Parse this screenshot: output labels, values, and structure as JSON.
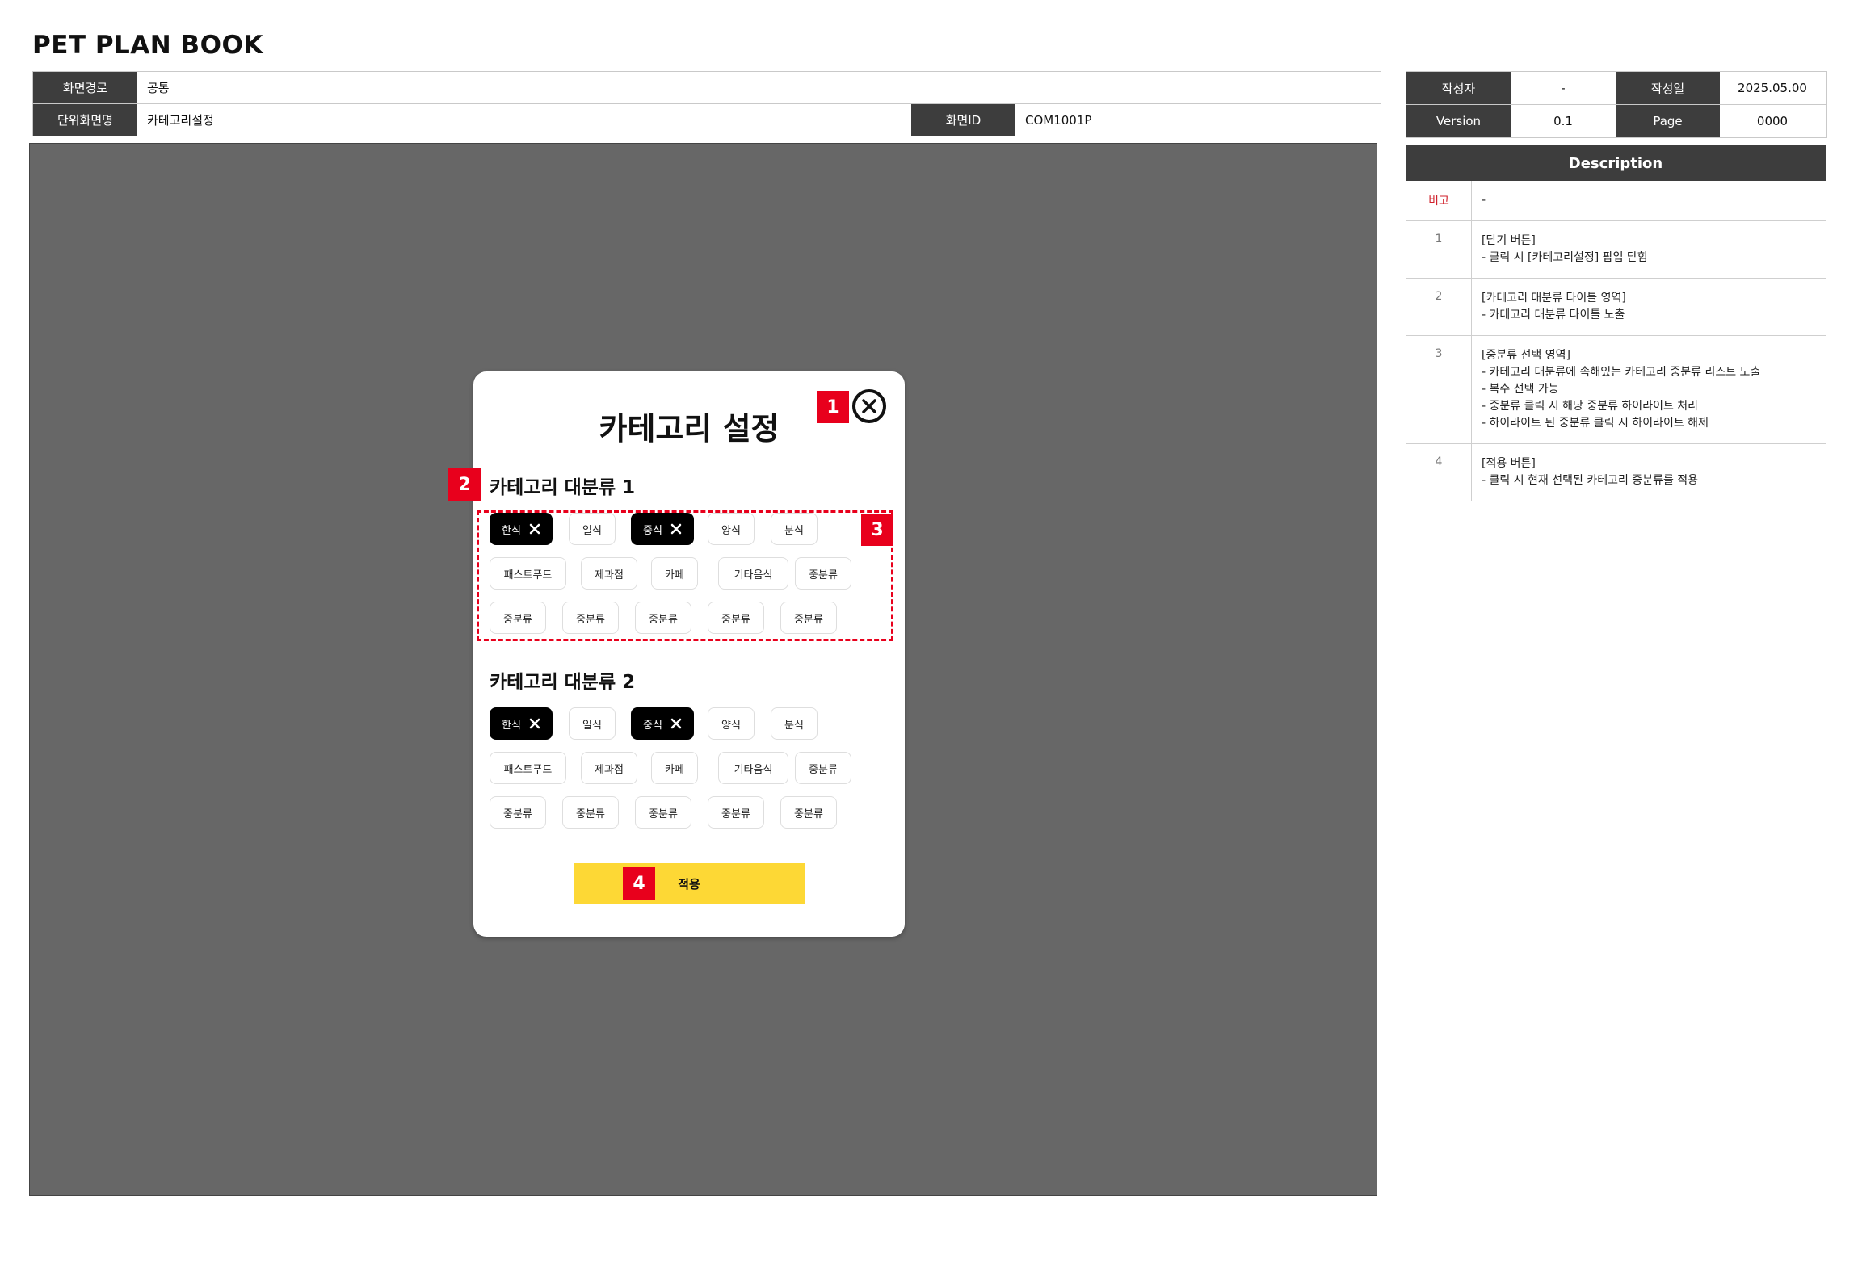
{
  "doc_title": "PET PLAN BOOK",
  "info": {
    "path_label": "화면경로",
    "path_value": "공통",
    "screen_name_label": "단위화면명",
    "screen_name_value": "카테고리설정",
    "screen_id_label": "화면ID",
    "screen_id_value": "COM1001P"
  },
  "meta": {
    "author_label": "작성자",
    "author_value": "-",
    "date_label": "작성일",
    "date_value": "2025.05.00",
    "version_label": "Version",
    "version_value": "0.1",
    "page_label": "Page",
    "page_value": "0000"
  },
  "description": {
    "title": "Description",
    "rows": [
      {
        "num": "비고",
        "lines": [
          "-"
        ]
      },
      {
        "num": "1",
        "lines": [
          "[닫기 버튼]",
          "- 클릭 시 [카테고리설정] 팝업 닫힘"
        ]
      },
      {
        "num": "2",
        "lines": [
          "[카테고리 대분류 타이틀 영역]",
          "- 카테고리 대분류 타이틀 노출"
        ]
      },
      {
        "num": "3",
        "lines": [
          "[중분류 선택 영역]",
          "- 카테고리 대분류에 속해있는 카테고리 중분류 리스트 노출",
          "- 복수 선택 가능",
          "- 중분류 클릭 시 해당 중분류 하이라이트 처리",
          "- 하이라이트 된 중분류 클릭 시 하이라이트 해제"
        ]
      },
      {
        "num": "4",
        "lines": [
          "[적용 버튼]",
          "- 클릭 시 현재 선택된 카테고리 중분류를 적용"
        ]
      }
    ]
  },
  "modal": {
    "title": "카테고리 설정",
    "apply_label": "적용",
    "sections": [
      {
        "title": "카테고리 대분류 1",
        "chips": [
          {
            "label": "한식",
            "selected": true
          },
          {
            "label": "일식",
            "selected": false
          },
          {
            "label": "중식",
            "selected": true
          },
          {
            "label": "양식",
            "selected": false
          },
          {
            "label": "분식",
            "selected": false
          },
          {
            "label": "패스트푸드",
            "selected": false
          },
          {
            "label": "제과점",
            "selected": false
          },
          {
            "label": "카페",
            "selected": false
          },
          {
            "label": "기타음식",
            "selected": false
          },
          {
            "label": "중분류",
            "selected": false
          },
          {
            "label": "중분류",
            "selected": false
          },
          {
            "label": "중분류",
            "selected": false
          },
          {
            "label": "중분류",
            "selected": false
          },
          {
            "label": "중분류",
            "selected": false
          },
          {
            "label": "중분류",
            "selected": false
          }
        ]
      },
      {
        "title": "카테고리 대분류 2",
        "chips": [
          {
            "label": "한식",
            "selected": true
          },
          {
            "label": "일식",
            "selected": false
          },
          {
            "label": "중식",
            "selected": true
          },
          {
            "label": "양식",
            "selected": false
          },
          {
            "label": "분식",
            "selected": false
          },
          {
            "label": "패스트푸드",
            "selected": false
          },
          {
            "label": "제과점",
            "selected": false
          },
          {
            "label": "카페",
            "selected": false
          },
          {
            "label": "기타음식",
            "selected": false
          },
          {
            "label": "중분류",
            "selected": false
          },
          {
            "label": "중분류",
            "selected": false
          },
          {
            "label": "중분류",
            "selected": false
          },
          {
            "label": "중분류",
            "selected": false
          },
          {
            "label": "중분류",
            "selected": false
          },
          {
            "label": "중분류",
            "selected": false
          }
        ]
      }
    ]
  },
  "markers": [
    "1",
    "2",
    "3",
    "4"
  ],
  "colors": {
    "accent": "#fdd835",
    "marker": "#e8001c",
    "header_bg": "#3d3d3d",
    "canvas_bg": "#676767"
  }
}
